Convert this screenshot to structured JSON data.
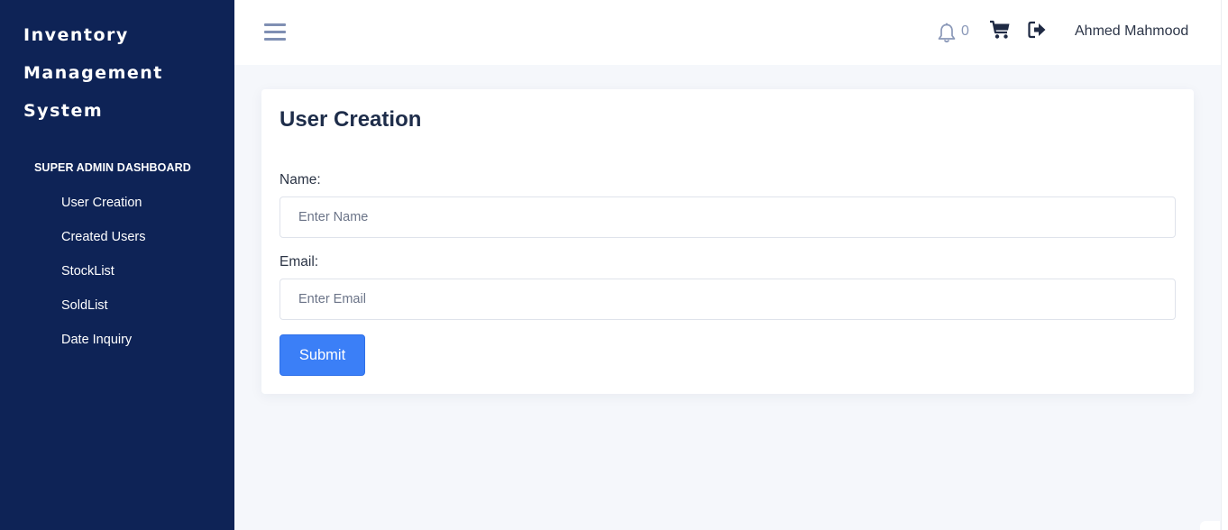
{
  "sidebar": {
    "brand_lines": [
      "Inventory",
      "Management",
      "System"
    ],
    "section_title": "SUPER ADMIN DASHBOARD",
    "items": [
      {
        "label": "User Creation"
      },
      {
        "label": "Created Users"
      },
      {
        "label": "StockList"
      },
      {
        "label": "SoldList"
      },
      {
        "label": "Date Inquiry"
      }
    ]
  },
  "header": {
    "notification_count": "0",
    "user_name": "Ahmed Mahmood",
    "icons": [
      "menu-icon",
      "bell-icon",
      "cart-icon",
      "logout-icon"
    ]
  },
  "form": {
    "title": "User Creation",
    "name_label": "Name:",
    "name_placeholder": "Enter Name",
    "name_value": "",
    "email_label": "Email:",
    "email_placeholder": "Enter Email",
    "email_value": "",
    "submit_label": "Submit"
  },
  "colors": {
    "sidebar_bg": "#0e2356",
    "primary": "#3b7ff7",
    "page_bg": "#f5f7fb"
  }
}
